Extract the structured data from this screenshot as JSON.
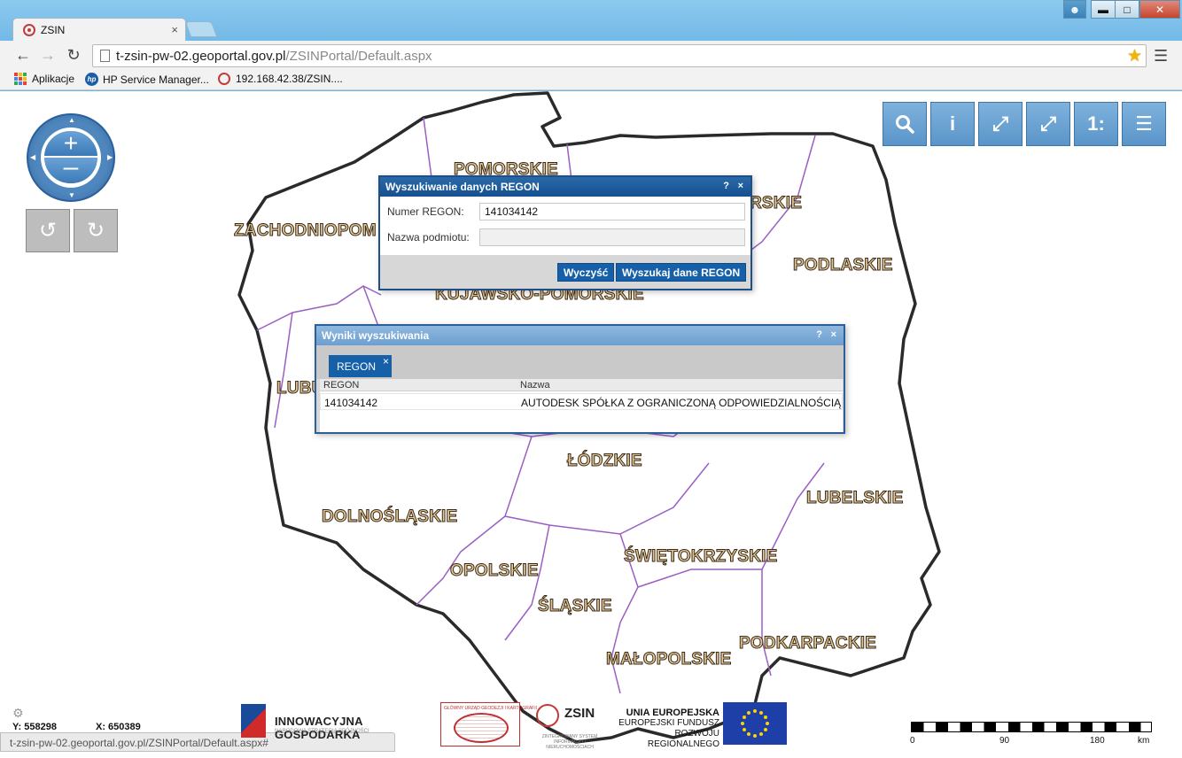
{
  "browser": {
    "tab_title": "ZSIN",
    "tab_close": "×",
    "url_host": "t-zsin-pw-02.geoportal.gov.pl",
    "url_path": "/ZSINPortal/Default.aspx",
    "bookmarks": [
      {
        "label": "Aplikacje"
      },
      {
        "label": "HP Service Manager..."
      },
      {
        "label": "192.168.42.38/ZSIN...."
      }
    ]
  },
  "map": {
    "regions": [
      {
        "id": "pomorskie",
        "label": "POMORSKIE"
      },
      {
        "id": "warminsko",
        "label": "RSKIE"
      },
      {
        "id": "zachodniopomorskie",
        "label": "ZACHODNIOPOM"
      },
      {
        "id": "podlaskie",
        "label": "PODLASKIE"
      },
      {
        "id": "kujawsko",
        "label": "KUJAWSKO-POMORSKIE"
      },
      {
        "id": "lubuskie",
        "label": "LUBU"
      },
      {
        "id": "lodzkie",
        "label": "ŁÓDZKIE"
      },
      {
        "id": "lubelskie",
        "label": "LUBELSKIE"
      },
      {
        "id": "dolnoslaskie",
        "label": "DOLNOŚLĄSKIE"
      },
      {
        "id": "swietokrzyskie",
        "label": "ŚWIĘTOKRZYSKIE"
      },
      {
        "id": "opolskie",
        "label": "OPOLSKIE"
      },
      {
        "id": "slaskie",
        "label": "ŚLĄSKIE"
      },
      {
        "id": "podkarpackie",
        "label": "PODKARPACKIE"
      },
      {
        "id": "malopolskie",
        "label": "MAŁOPOLSKIE"
      }
    ],
    "coords": {
      "y_label": "Y: 558298",
      "x_label": "X: 650389"
    },
    "scale": {
      "ticks": [
        "0",
        "90",
        "180",
        "km"
      ]
    },
    "status_url": "t-zsin-pw-02.geoportal.gov.pl/ZSINPortal/Default.aspx#"
  },
  "logos": {
    "innowacyjna": "INNOWACYJNA GOSPODARKA",
    "innowacyjna_sub": "NARODOWA STRATEGIA SPÓJNOŚCI",
    "gugik": "GŁÓWNY URZĄD GEODEZJI I KARTOGRAFII",
    "zsin": "ZSIN",
    "zsin_sub": "ZINTEGROWANY SYSTEM INFORMACJI O NIERUCHOMOŚCIACH",
    "ue_title": "UNIA EUROPEJSKA",
    "ue_line2": "EUROPEJSKI FUNDUSZ",
    "ue_line3": "ROZWOJU REGIONALNEGO"
  },
  "search_dialog": {
    "title": "Wyszukiwanie danych REGON",
    "help": "?",
    "close": "×",
    "regon_label": "Numer REGON:",
    "regon_value": "141034142",
    "name_label": "Nazwa podmiotu:",
    "name_value": "",
    "clear_button": "Wyczyść",
    "search_button": "Wyszukaj dane REGON"
  },
  "results_dialog": {
    "title": "Wyniki wyszukiwania",
    "help": "?",
    "close": "×",
    "tab_label": "REGON",
    "tab_close": "×",
    "columns": [
      "REGON",
      "Nazwa"
    ],
    "rows": [
      {
        "regon": "141034142",
        "nazwa": "AUTODESK SPÓŁKA Z OGRANICZONĄ ODPOWIEDZIALNOŚCIĄ"
      }
    ]
  }
}
